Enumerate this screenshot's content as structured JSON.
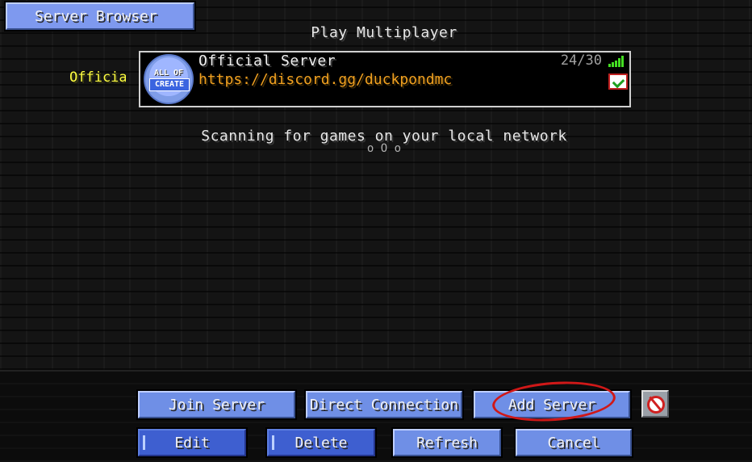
{
  "header": {
    "server_browser_tab": "Server Browser",
    "title": "Play Multiplayer"
  },
  "server_list": {
    "side_label": "Official Server",
    "entries": [
      {
        "name": "Official Server",
        "motd": "https://discord.gg/duckpondmc",
        "players": "24/30",
        "icon_text_top": "ALL OF",
        "icon_text_main": "CREATE",
        "status_icon": "check-icon",
        "signal_icon": "signal-bars-icon"
      }
    ]
  },
  "lan": {
    "scanning_text": "Scanning for games on your local network",
    "scanning_anim": "o O o"
  },
  "buttons": {
    "join": "Join Server",
    "direct": "Direct Connection",
    "add": "Add Server",
    "edit": "Edit",
    "delete": "Delete",
    "refresh": "Refresh",
    "cancel": "Cancel",
    "extra_icon": "no-chat-reporting-icon"
  },
  "colors": {
    "button": "#6f8fe6",
    "motd": "#f0a020",
    "official_label": "#ffff40",
    "highlight": "#d01818"
  }
}
